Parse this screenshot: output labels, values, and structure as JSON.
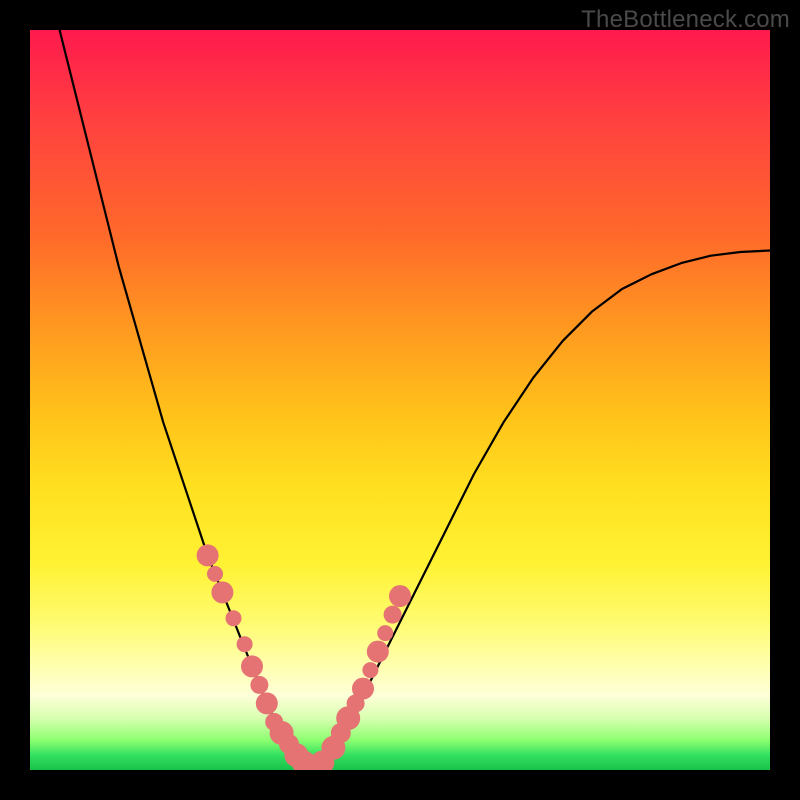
{
  "watermark": "TheBottleneck.com",
  "colors": {
    "frame": "#000000",
    "curve": "#000000",
    "marker_fill": "#e57373",
    "marker_stroke": "#c24e4e"
  },
  "chart_data": {
    "type": "line",
    "title": "",
    "xlabel": "",
    "ylabel": "",
    "xlim": [
      0,
      100
    ],
    "ylim": [
      0,
      100
    ],
    "grid": false,
    "legend": false,
    "series": [
      {
        "name": "bottleneck-curve",
        "x": [
          4,
          6,
          8,
          10,
          12,
          14,
          16,
          18,
          20,
          22,
          24,
          26,
          28,
          30,
          32,
          34,
          36,
          38,
          40,
          44,
          48,
          52,
          56,
          60,
          64,
          68,
          72,
          76,
          80,
          84,
          88,
          92,
          96,
          100
        ],
        "y": [
          100,
          92,
          84,
          76,
          68,
          61,
          54,
          47,
          41,
          35,
          29,
          24,
          19,
          14,
          9,
          5,
          2,
          0.5,
          2,
          8,
          16,
          24,
          32,
          40,
          47,
          53,
          58,
          62,
          65,
          67,
          68.5,
          69.5,
          70,
          70.2
        ]
      }
    ],
    "markers": {
      "name": "highlight-points",
      "x": [
        24,
        25,
        26,
        27.5,
        29,
        30,
        31,
        32,
        33,
        34,
        35,
        36,
        37,
        38,
        39.5,
        41,
        42,
        43,
        44,
        45,
        46,
        47,
        48,
        49,
        50
      ],
      "y": [
        29,
        26.5,
        24,
        20.5,
        17,
        14,
        11.5,
        9,
        6.5,
        5,
        3.5,
        2,
        1,
        0.5,
        1,
        3,
        5,
        7,
        9,
        11,
        13.5,
        16,
        18.5,
        21,
        23.5
      ],
      "size": [
        11,
        8,
        11,
        8,
        8,
        11,
        9,
        11,
        9,
        12,
        10,
        12,
        12,
        12,
        12,
        12,
        10,
        12,
        9,
        11,
        8,
        11,
        8,
        9,
        11
      ]
    }
  }
}
